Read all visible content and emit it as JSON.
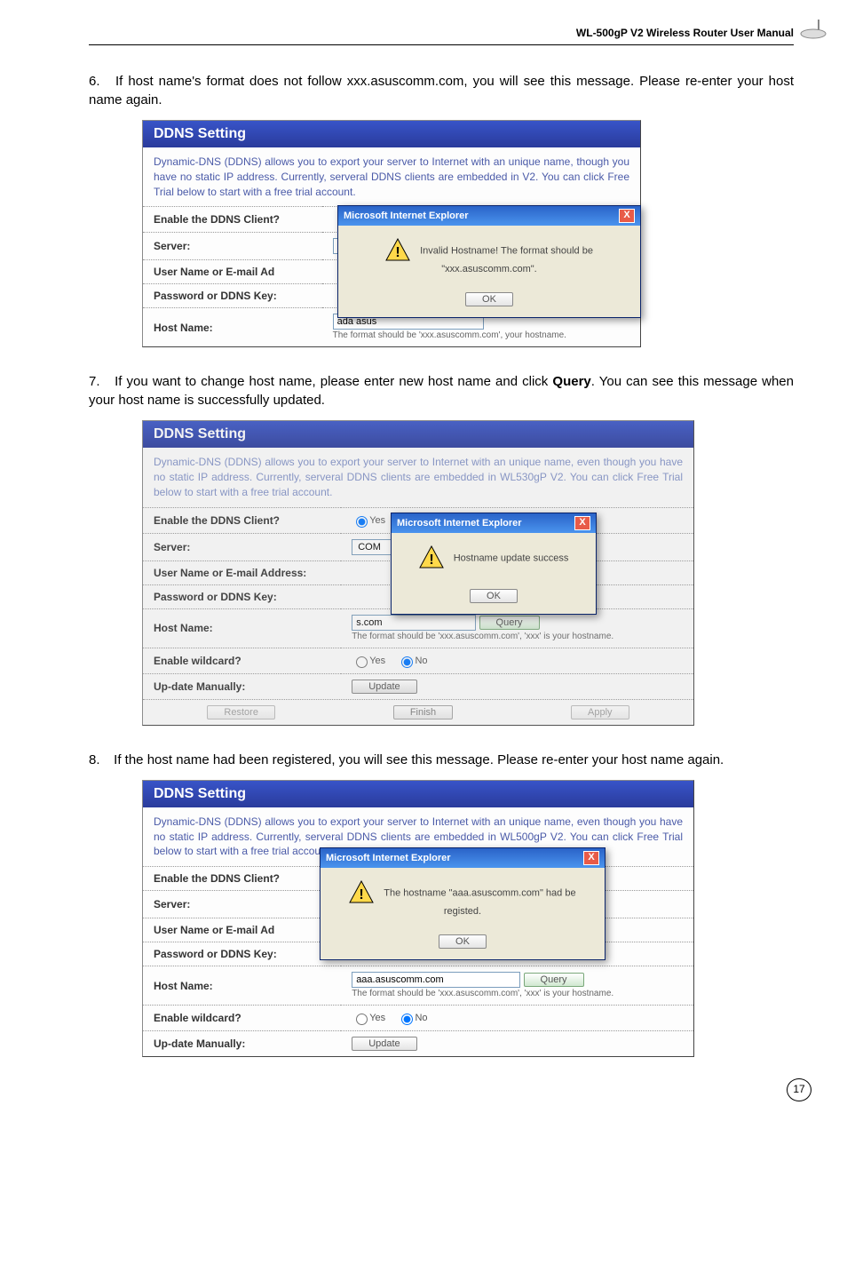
{
  "header": {
    "title": "WL-500gP V2 Wireless Router User Manual"
  },
  "steps": {
    "s6": {
      "num": "6.",
      "text": "If host name's format does not follow xxx.asuscomm.com, you will see this message. Please re-enter your host name again."
    },
    "s7": {
      "num": "7.",
      "text_a": "If you want to change host name, please enter new host name and click ",
      "bold": "Query",
      "text_b": ". You can see this message when your host name is successfully updated."
    },
    "s8": {
      "num": "8.",
      "text": "If the host name had been registered, you will see this message. Please re-enter your host name again."
    }
  },
  "ddns": {
    "title": "DDNS Setting",
    "desc1": "Dynamic-DNS (DDNS) allows you to export your server to Internet with an unique name, though you have no static IP address. Currently, serveral DDNS clients are embedded in V2. You can click Free Trial below to start with a free trial account.",
    "desc2": "Dynamic-DNS (DDNS) allows you to export your server to Internet with an unique name, even though you have no static IP address. Currently, serveral DDNS clients are embedded in WL530gP V2. You can click Free Trial below to start with a free trial account.",
    "desc3": "Dynamic-DNS (DDNS) allows you to export your server to Internet with an unique name, even though you have no static IP address. Currently, serveral DDNS clients are embedded in WL500gP V2. You can click Free Trial below to start with a free trial account.",
    "enable": "Enable the DDNS Client?",
    "server": "Server:",
    "user": "User Name or E-mail Address:",
    "user_short": "User Name or E-mail Ad",
    "pass": "Password or DDNS Key:",
    "host": "Host Name:",
    "wildcard": "Enable wildcard?",
    "update": "Up-date Manually:",
    "yes": "Yes",
    "no": "No",
    "com_opt": "COM",
    "hostval1": "ada asus",
    "hostval2": "s.com",
    "hostval3": "aaa.asuscomm.com",
    "hint1": "The format should be 'xxx.asuscomm.com', your hostname.",
    "hint2": "The format should be 'xxx.asuscomm.com', 'xxx' is your hostname.",
    "query": "Query",
    "updatebtn": "Update",
    "restore": "Restore",
    "finish": "Finish",
    "apply": "Apply"
  },
  "ie": {
    "title": "Microsoft Internet Explorer",
    "msg1": "Invalid Hostname! The format should be \"xxx.asuscomm.com\".",
    "msg2": "Hostname update success",
    "msg3": "The hostname \"aaa.asuscomm.com\" had be registed.",
    "ok": "OK",
    "close": "X"
  },
  "page_number": "17"
}
